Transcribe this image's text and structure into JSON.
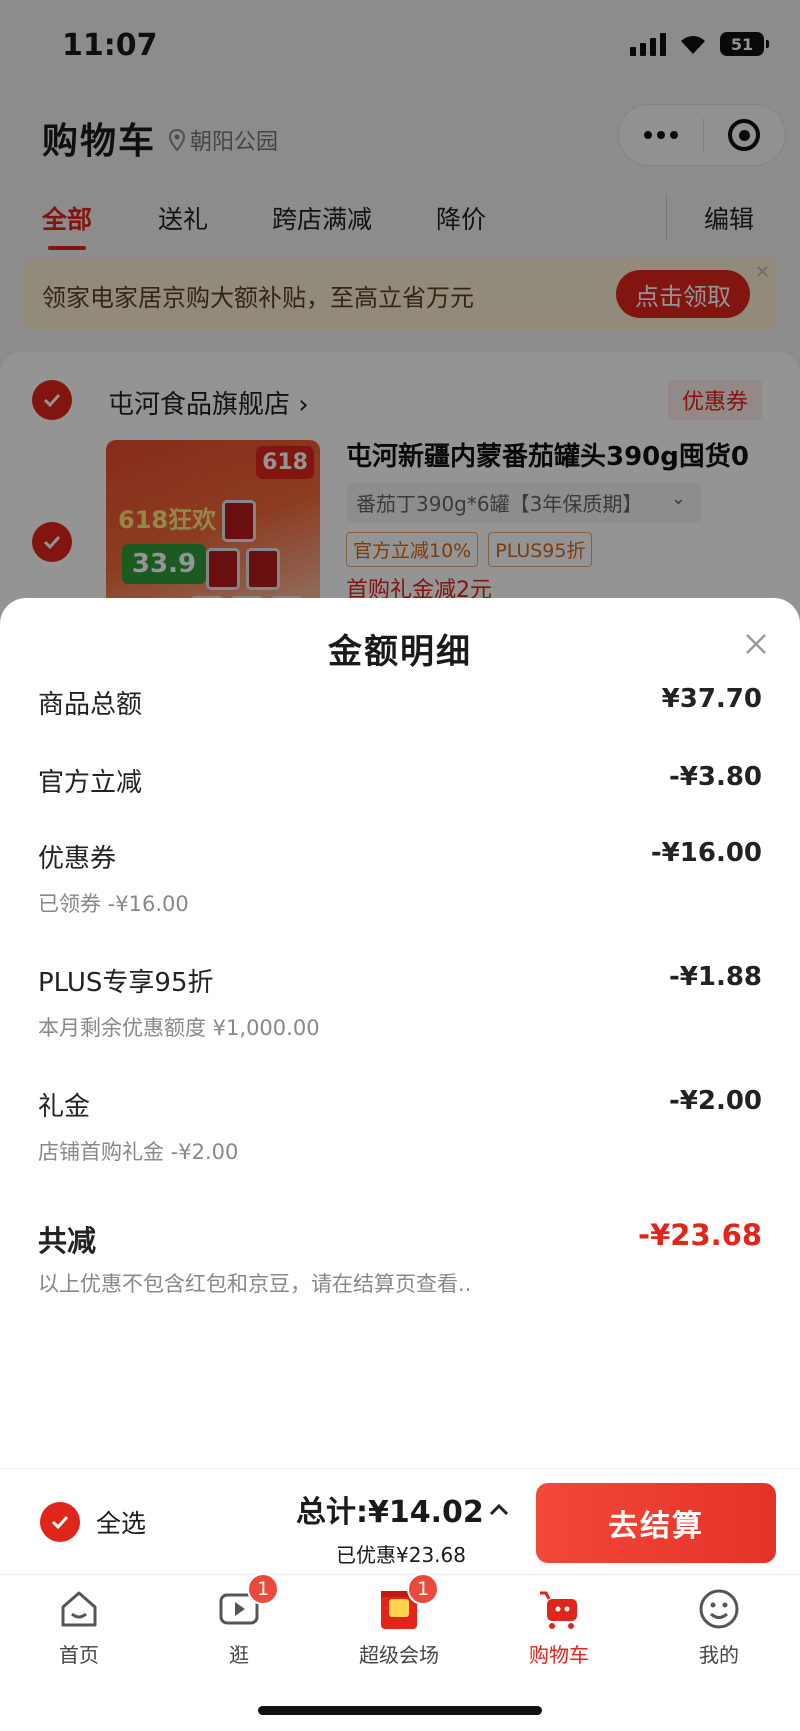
{
  "status_bar": {
    "time": "11:07",
    "battery": "51"
  },
  "header": {
    "title": "购物车",
    "location": "朝阳公园"
  },
  "tabs": [
    {
      "label": "全部",
      "active": true
    },
    {
      "label": "送礼",
      "active": false
    },
    {
      "label": "跨店满减",
      "active": false
    },
    {
      "label": "降价",
      "active": false
    },
    {
      "label": "编辑",
      "active": false
    }
  ],
  "promo": {
    "text": "领家电家居京购大额补贴，至高立省万元",
    "button": "点击领取"
  },
  "store": {
    "name": "屯河食品旗舰店 ›",
    "coupon_tag": "优惠券",
    "item": {
      "title": "屯河新疆内蒙番茄罐头390g囤货0",
      "spec": "番茄丁390g*6罐【3年保质期】",
      "tags": [
        "官方立减10%",
        "PLUS95折"
      ],
      "gift": "首购礼金减2元",
      "thumb_badge": "618",
      "thumb_festival": "618狂欢",
      "thumb_price": "33.9"
    }
  },
  "sheet": {
    "title": "金额明细",
    "rows": [
      {
        "label": "商品总额",
        "amount": "¥37.70",
        "sub": ""
      },
      {
        "label": "官方立减",
        "amount": "-¥3.80",
        "sub": ""
      },
      {
        "label": "优惠券",
        "amount": "-¥16.00",
        "sub": "已领券 -¥16.00"
      },
      {
        "label": "PLUS专享95折",
        "amount": "-¥1.88",
        "sub": "本月剩余优惠额度 ¥1,000.00"
      },
      {
        "label": "礼金",
        "amount": "-¥2.00",
        "sub": "店铺首购礼金 -¥2.00"
      }
    ],
    "total": {
      "label": "共减",
      "amount": "-¥23.68",
      "note": "以上优惠不包含红包和京豆，请在结算页查看.."
    }
  },
  "checkout": {
    "select_all": "全选",
    "total_prefix": "总计:",
    "total_amount": "¥14.02",
    "saved": "已优惠¥23.68",
    "button": "去结算"
  },
  "tabbar": [
    {
      "label": "首页",
      "icon": "home-icon",
      "badge": ""
    },
    {
      "label": "逛",
      "icon": "video-icon",
      "badge": "1"
    },
    {
      "label": "超级会场",
      "icon": "venue-icon",
      "badge": "1"
    },
    {
      "label": "购物车",
      "icon": "cart-icon",
      "badge": "",
      "active": true
    },
    {
      "label": "我的",
      "icon": "profile-icon",
      "badge": ""
    }
  ],
  "colors": {
    "accent": "#e1251b",
    "promo_bg": "#fbefd4"
  }
}
